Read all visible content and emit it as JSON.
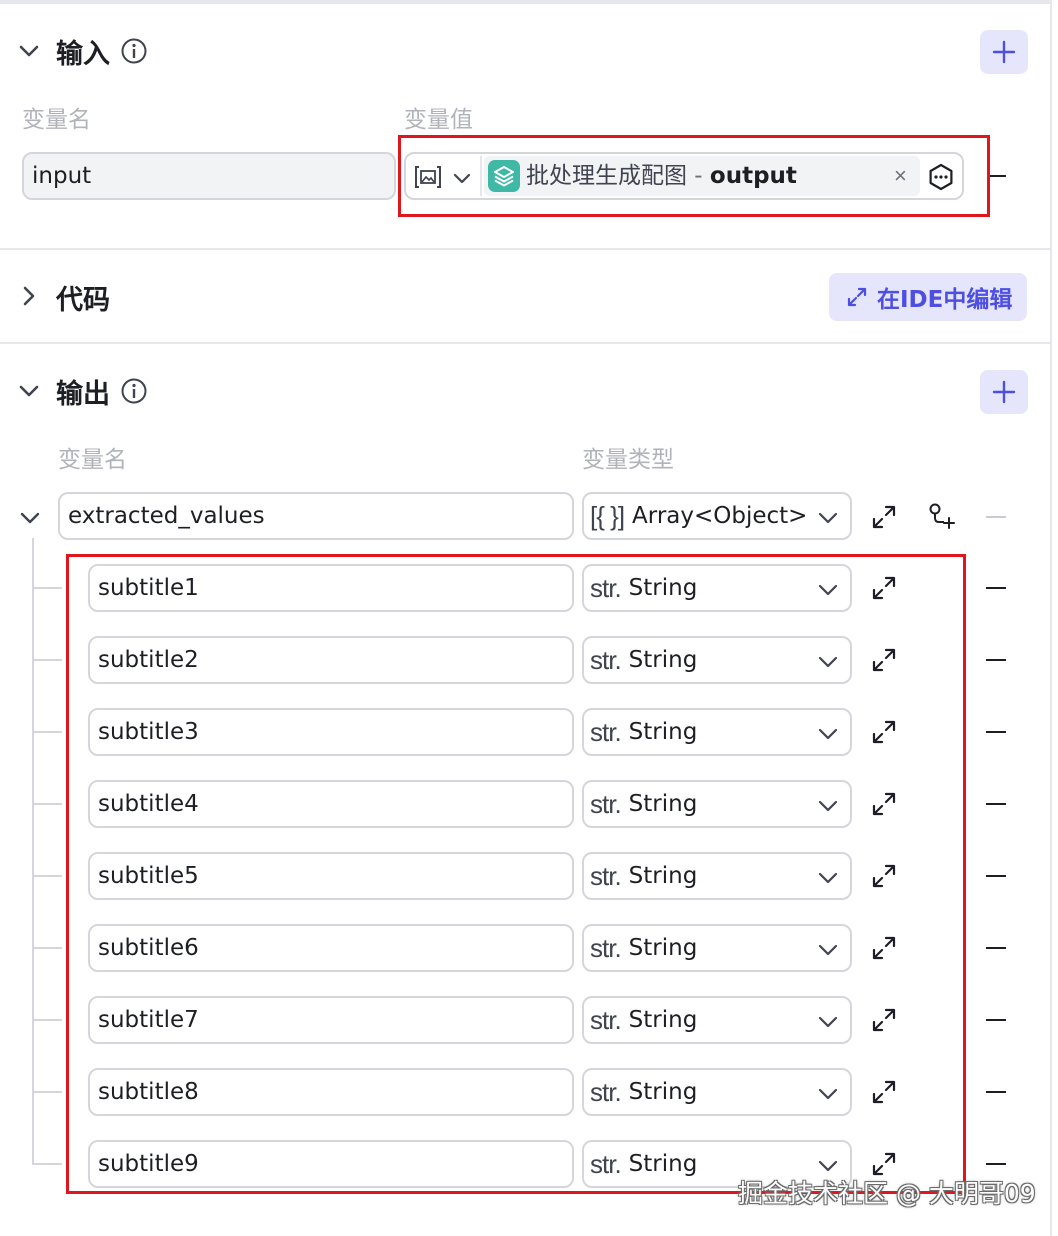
{
  "input_section": {
    "title": "输入",
    "col_name": "变量名",
    "col_value": "变量值",
    "var_name": "input",
    "ref_label": "批处理生成配图",
    "ref_sep": " - ",
    "ref_field": "output",
    "clear_symbol": "×"
  },
  "code_section": {
    "title": "代码",
    "ide_button": "在IDE中编辑"
  },
  "output_section": {
    "title": "输出",
    "col_name": "变量名",
    "col_type": "变量类型",
    "parent": {
      "name": "extracted_values",
      "type_prefix": "[{ }]",
      "type": "Array<Object>"
    },
    "children": [
      {
        "name": "subtitle1",
        "type_prefix": "str.",
        "type": "String"
      },
      {
        "name": "subtitle2",
        "type_prefix": "str.",
        "type": "String"
      },
      {
        "name": "subtitle3",
        "type_prefix": "str.",
        "type": "String"
      },
      {
        "name": "subtitle4",
        "type_prefix": "str.",
        "type": "String"
      },
      {
        "name": "subtitle5",
        "type_prefix": "str.",
        "type": "String"
      },
      {
        "name": "subtitle6",
        "type_prefix": "str.",
        "type": "String"
      },
      {
        "name": "subtitle7",
        "type_prefix": "str.",
        "type": "String"
      },
      {
        "name": "subtitle8",
        "type_prefix": "str.",
        "type": "String"
      },
      {
        "name": "subtitle9",
        "type_prefix": "str.",
        "type": "String"
      }
    ]
  },
  "watermark": "掘金技术社区 @ 大明哥09",
  "colors": {
    "accent": "#4e4fe0",
    "accent_bg": "#e5e6fb",
    "highlight": "#e0161e",
    "ref_icon": "#3fb8a6"
  }
}
